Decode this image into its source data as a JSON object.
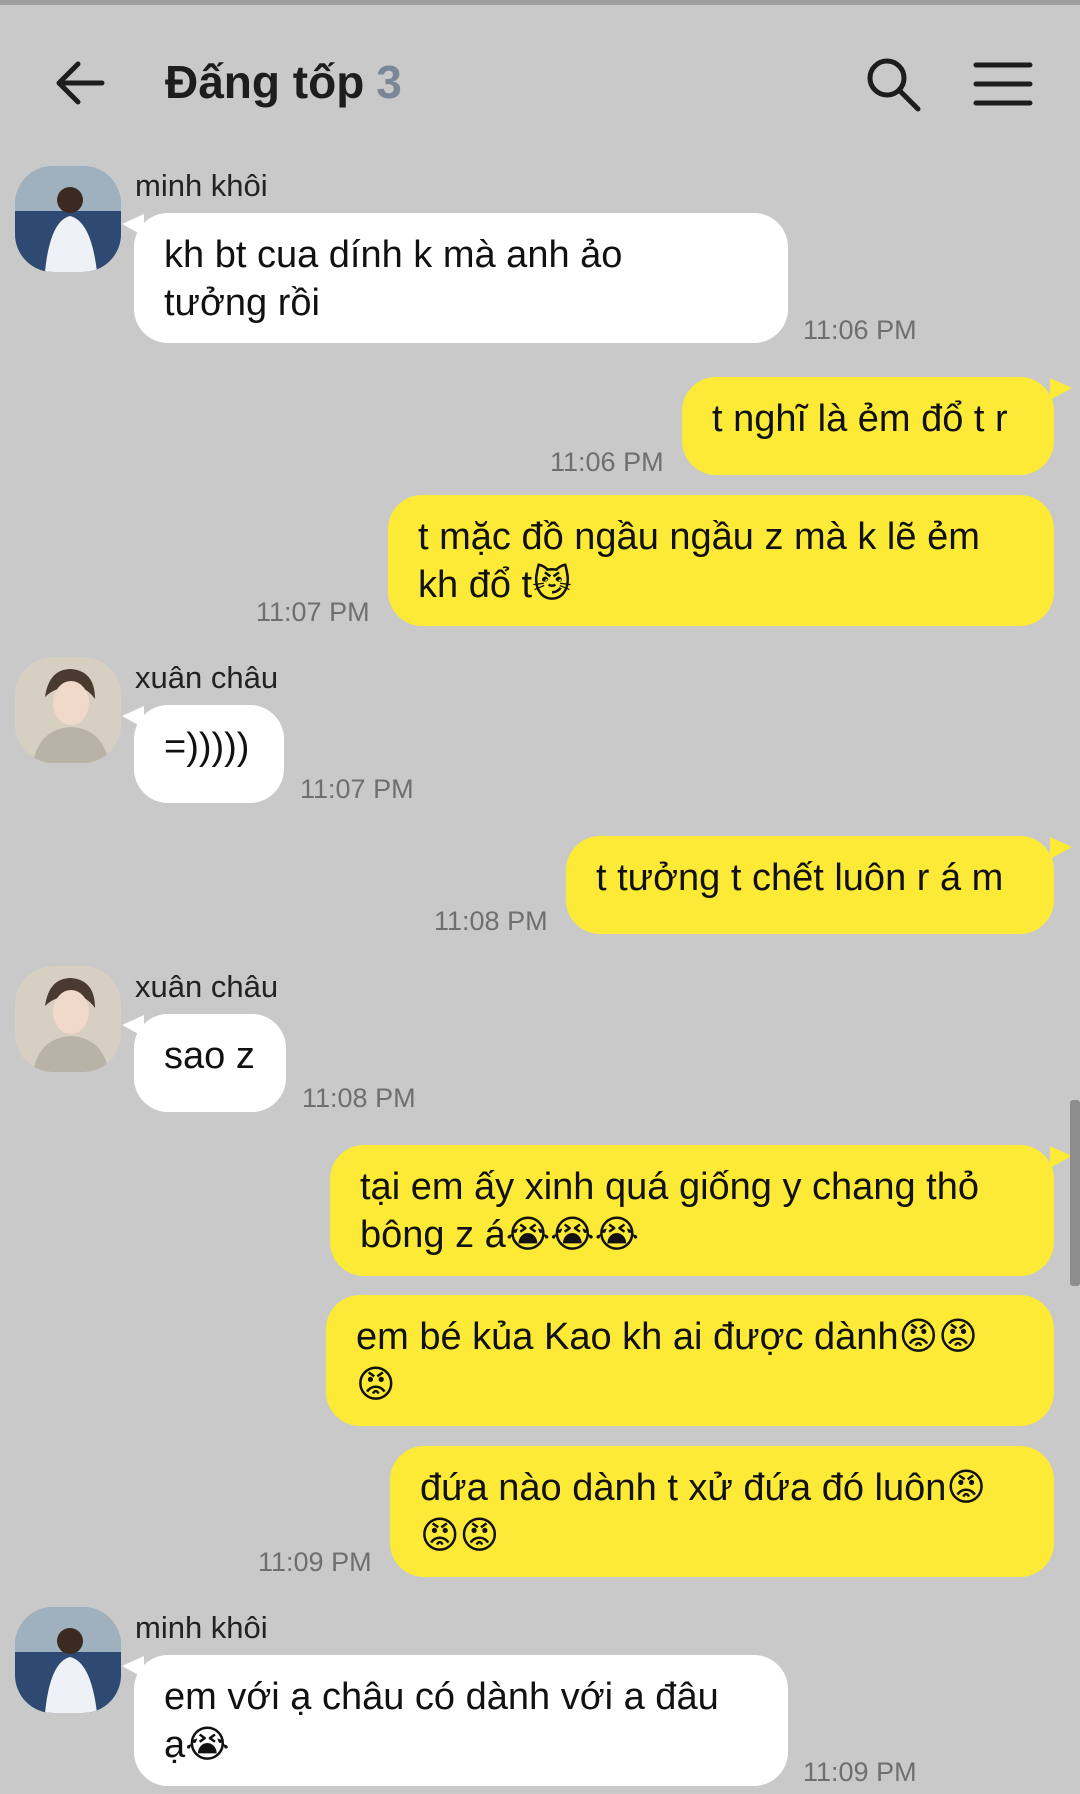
{
  "header": {
    "title": "Đấng tốp",
    "member_count": "3",
    "back_icon": "arrow-left-icon",
    "search_icon": "search-icon",
    "menu_icon": "hamburger-menu-icon"
  },
  "colors": {
    "background": "#c9c9c9",
    "incoming_bubble": "#ffffff",
    "outgoing_bubble": "#fdea36"
  },
  "messages": [
    {
      "sender": "minh khôi",
      "text1": "kh bt cua dính k mà anh ảo",
      "text2": "tưởng rồi",
      "time": "11:06 PM"
    },
    {
      "text1": "t nghĩ là ẻm đổ t r",
      "time": "11:06 PM"
    },
    {
      "text1": "t mặc đồ ngầu ngầu z mà k lẽ ẻm",
      "text2": "kh đổ t😼",
      "time": "11:07 PM"
    },
    {
      "sender": "xuân châu",
      "text1": "=)))))",
      "time": "11:07 PM"
    },
    {
      "text1": "t tưởng t chết luôn r á m",
      "time": "11:08 PM"
    },
    {
      "sender": "xuân châu",
      "text1": "sao z",
      "time": "11:08 PM"
    },
    {
      "text1": "tại em ấy xinh quá giống y chang thỏ",
      "text2": "bông z á😭😭😭"
    },
    {
      "text1": "em bé kủa Kao kh ai được dành😡😡",
      "text2": "😡"
    },
    {
      "text1": "đứa nào dành t xử đứa đó luôn😡",
      "text2": "😡😡",
      "time": "11:09 PM"
    },
    {
      "sender": "minh khôi",
      "text1": "em với ạ châu có dành với a đâu",
      "text2": "ạ😭",
      "time": "11:09 PM"
    }
  ]
}
